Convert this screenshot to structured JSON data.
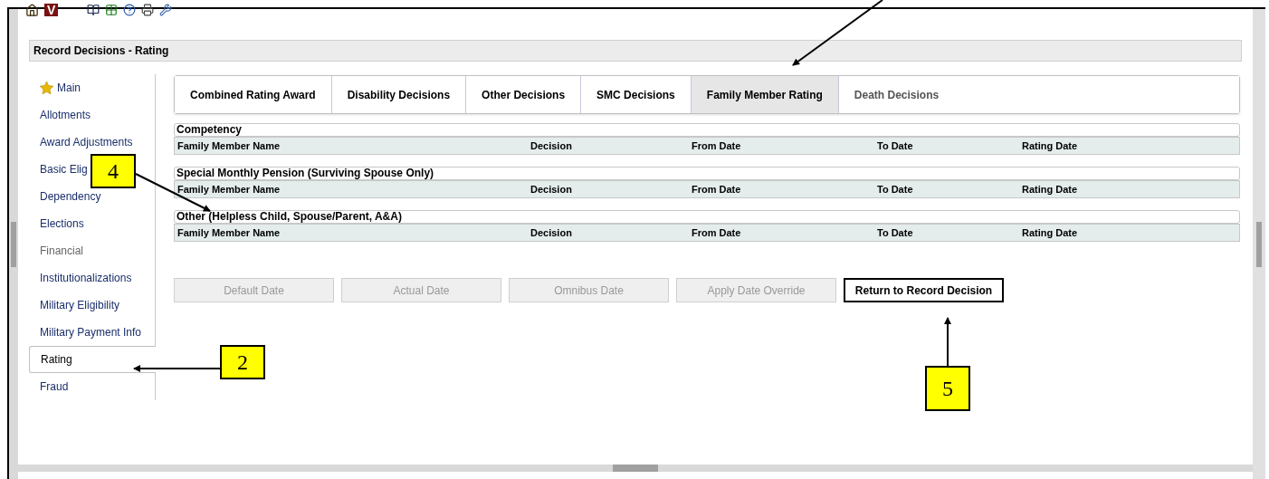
{
  "toolbar": {
    "logo": "V"
  },
  "header": {
    "title": "Record Decisions - Rating"
  },
  "sidebar": {
    "items": [
      {
        "label": "Main",
        "selected": false,
        "disabled": false,
        "kind": "star"
      },
      {
        "label": "Allotments",
        "selected": false,
        "disabled": false,
        "kind": "plain"
      },
      {
        "label": "Award Adjustments",
        "selected": false,
        "disabled": false,
        "kind": "plain"
      },
      {
        "label": "Basic Elig",
        "selected": false,
        "disabled": false,
        "kind": "plain"
      },
      {
        "label": "Dependency",
        "selected": false,
        "disabled": false,
        "kind": "plain"
      },
      {
        "label": "Elections",
        "selected": false,
        "disabled": false,
        "kind": "plain"
      },
      {
        "label": "Financial",
        "selected": false,
        "disabled": true,
        "kind": "plain"
      },
      {
        "label": "Institutionalizations",
        "selected": false,
        "disabled": false,
        "kind": "plain"
      },
      {
        "label": "Military Eligibility",
        "selected": false,
        "disabled": false,
        "kind": "plain"
      },
      {
        "label": "Military Payment Info",
        "selected": false,
        "disabled": false,
        "kind": "plain"
      },
      {
        "label": "Rating",
        "selected": true,
        "disabled": false,
        "kind": "plain"
      },
      {
        "label": "Fraud",
        "selected": false,
        "disabled": false,
        "kind": "plain"
      }
    ]
  },
  "tabs": [
    {
      "label": "Combined Rating Award",
      "selected": false,
      "disabled": false
    },
    {
      "label": "Disability Decisions",
      "selected": false,
      "disabled": false
    },
    {
      "label": "Other Decisions",
      "selected": false,
      "disabled": false
    },
    {
      "label": "SMC Decisions",
      "selected": false,
      "disabled": false
    },
    {
      "label": "Family Member Rating",
      "selected": true,
      "disabled": false
    },
    {
      "label": "Death Decisions",
      "selected": false,
      "disabled": true
    }
  ],
  "sections": [
    {
      "title": "Competency",
      "columns": [
        "Family Member Name",
        "Decision",
        "From Date",
        "To Date",
        "Rating Date"
      ]
    },
    {
      "title": "Special Monthly Pension (Surviving Spouse Only)",
      "columns": [
        "Family Member Name",
        "Decision",
        "From Date",
        "To Date",
        "Rating Date"
      ]
    },
    {
      "title": "Other (Helpless Child, Spouse/Parent, A&A)",
      "columns": [
        "Family Member Name",
        "Decision",
        "From Date",
        "To Date",
        "Rating Date"
      ]
    }
  ],
  "buttons": [
    {
      "label": "Default Date",
      "disabled": true
    },
    {
      "label": "Actual Date",
      "disabled": true
    },
    {
      "label": "Omnibus Date",
      "disabled": true
    },
    {
      "label": "Apply Date Override",
      "disabled": true
    },
    {
      "label": "Return to Record Decision",
      "disabled": false
    }
  ],
  "callouts": [
    {
      "label": "4"
    },
    {
      "label": "2"
    },
    {
      "label": "5"
    }
  ]
}
